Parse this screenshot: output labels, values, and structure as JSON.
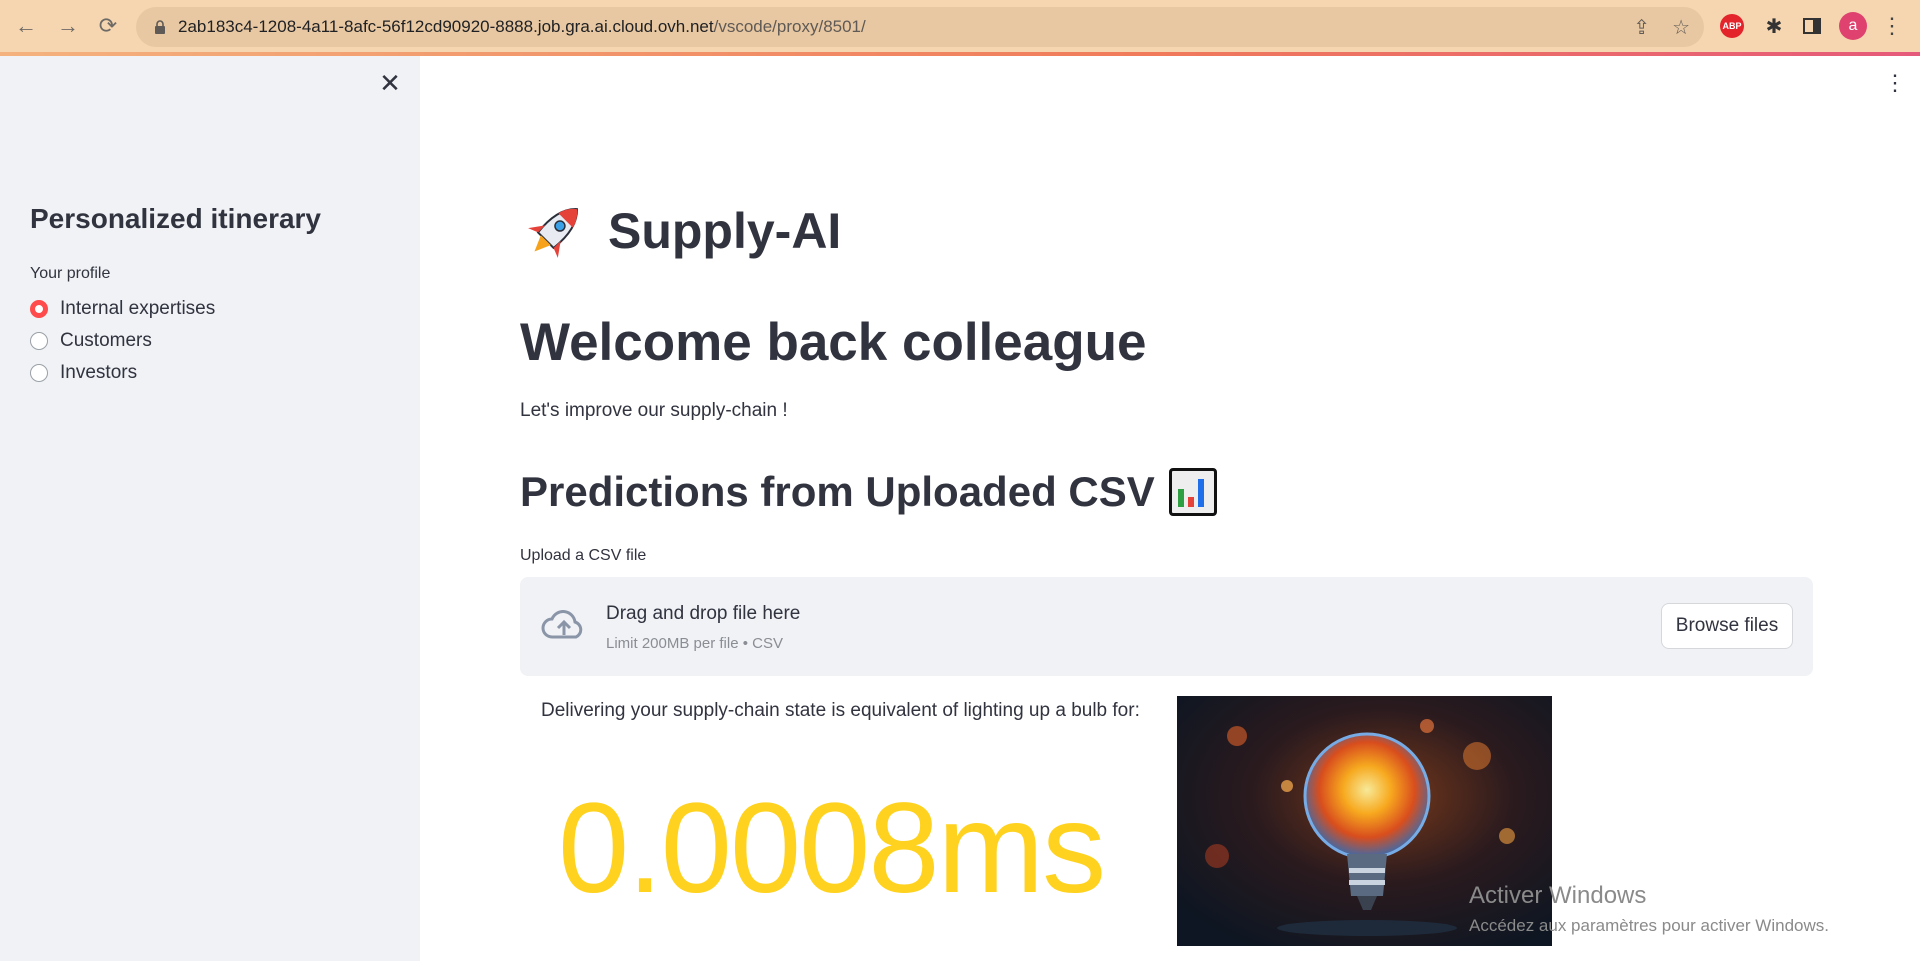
{
  "browser": {
    "url_host": "2ab183c4-1208-4a11-8afc-56f12cd90920-8888.job.gra.ai.cloud.ovh.net",
    "url_path": "/vscode/proxy/8501/",
    "profile_initial": "a",
    "abp_label": "ABP"
  },
  "sidebar": {
    "title": "Personalized itinerary",
    "profile_label": "Your profile",
    "options": [
      {
        "label": "Internal expertises",
        "selected": true
      },
      {
        "label": "Customers",
        "selected": false
      },
      {
        "label": "Investors",
        "selected": false
      }
    ]
  },
  "main": {
    "app_title": "Supply-AI",
    "welcome": "Welcome back colleague",
    "subtitle": "Let's improve our supply-chain !",
    "predictions_title": "Predictions from Uploaded CSV",
    "upload_label": "Upload a CSV file",
    "dropzone_main": "Drag and drop file here",
    "dropzone_sub": "Limit 200MB per file • CSV",
    "browse_label": "Browse files",
    "delivering_text": "Delivering your supply-chain state is equivalent of lighting up a bulb for:",
    "result_value": "0.0008ms"
  },
  "overlay": {
    "activate_title": "Activer Windows",
    "activate_sub": "Accédez aux paramètres pour activer Windows."
  },
  "colors": {
    "accent_red": "#ff4b4b",
    "result_yellow": "#ffd21f",
    "sidebar_bg": "#f0f2f6",
    "text": "#31333f"
  }
}
